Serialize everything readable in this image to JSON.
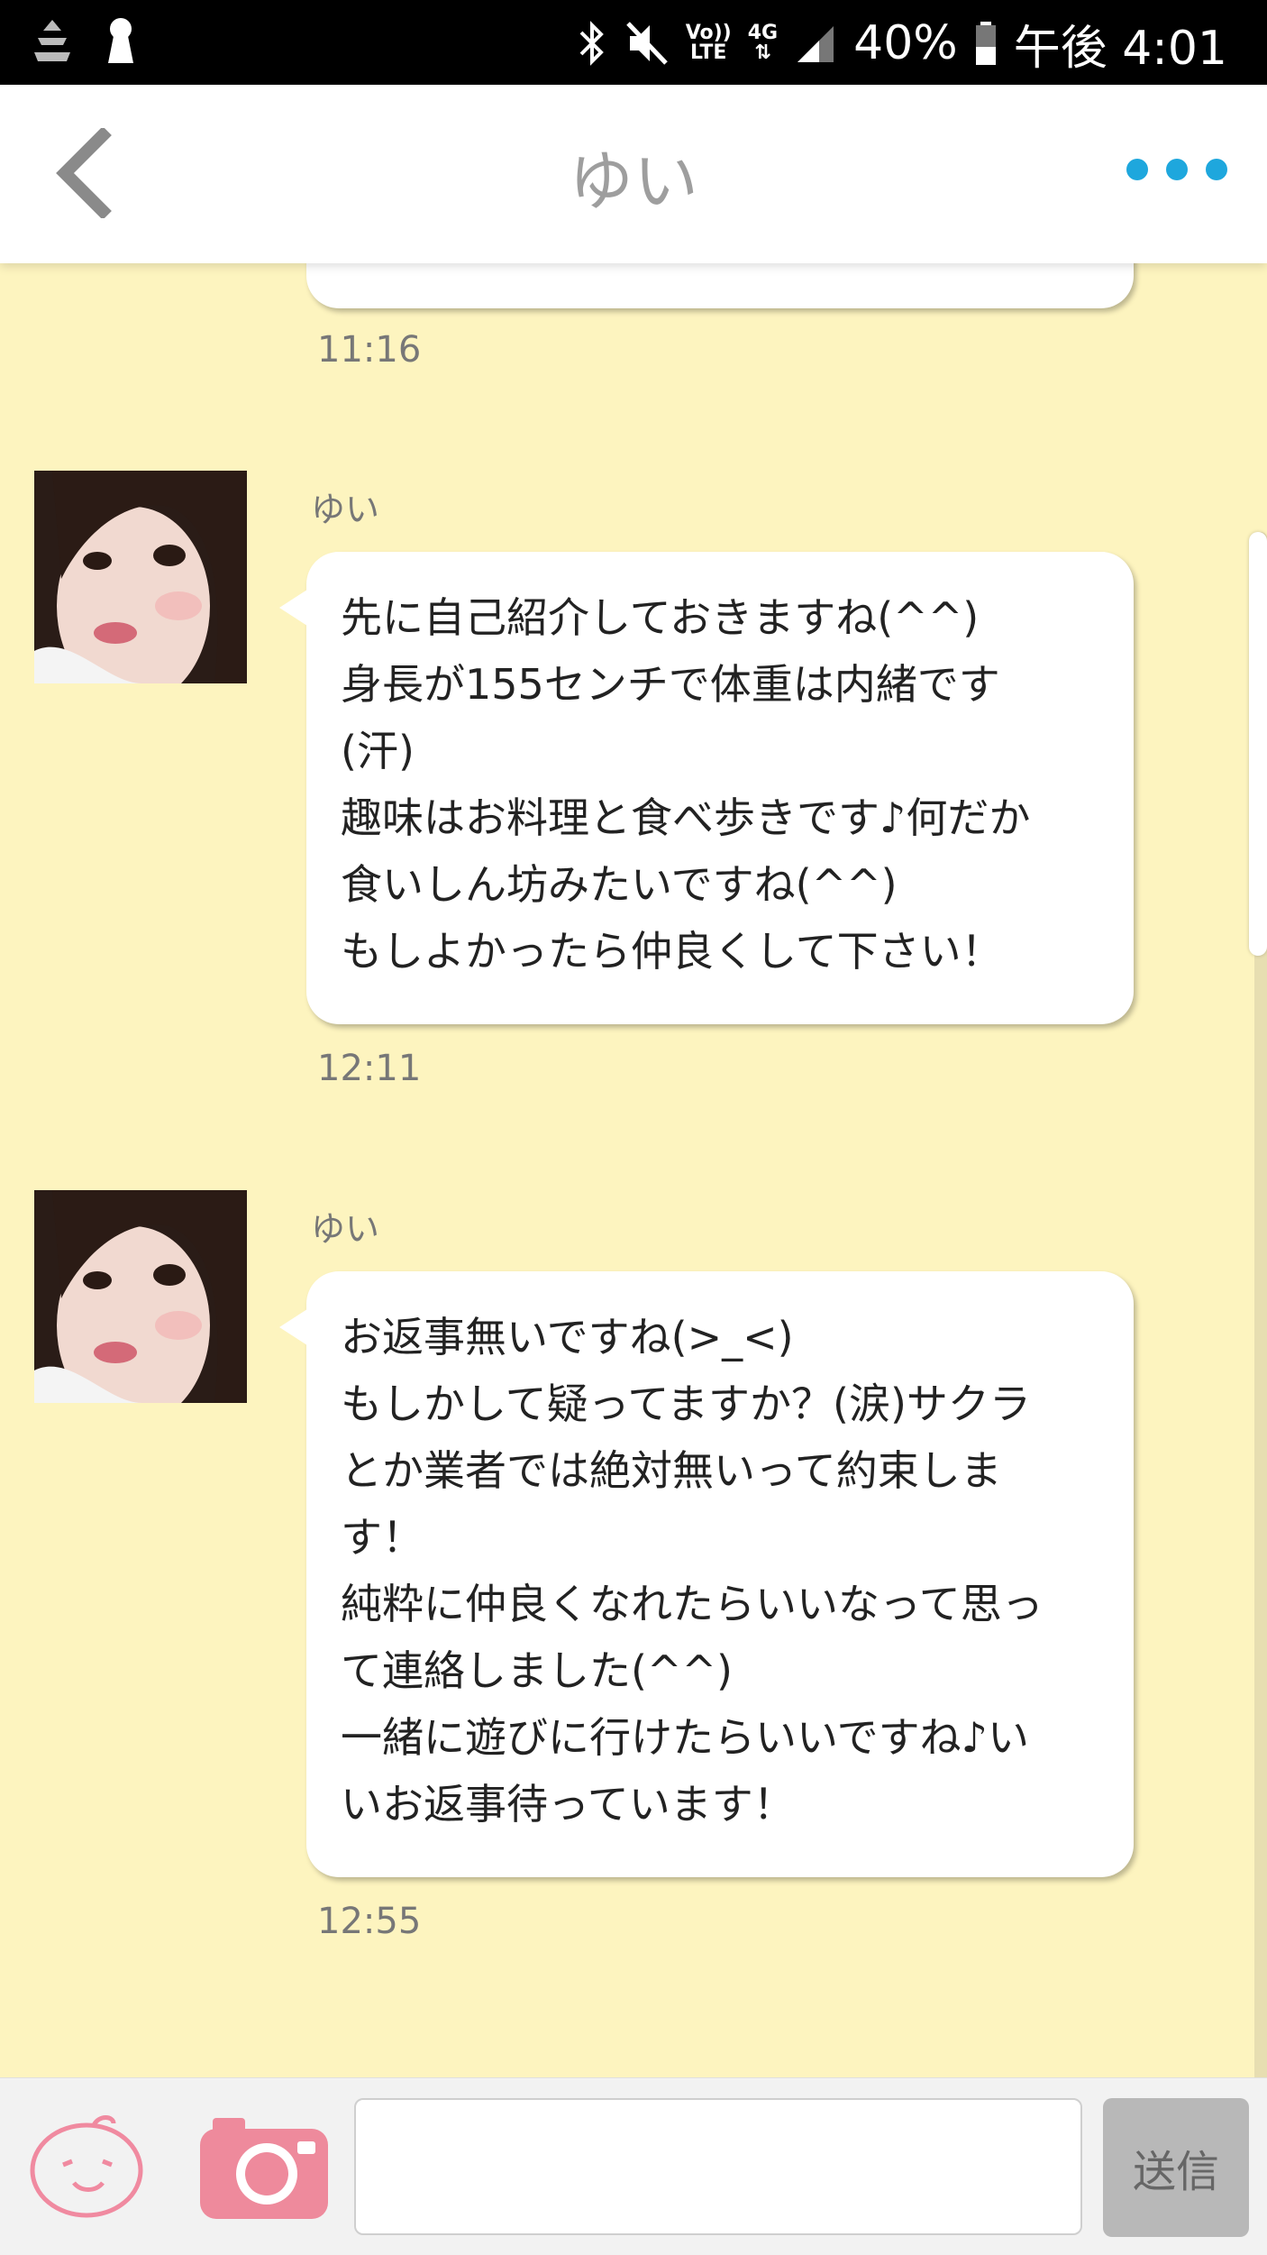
{
  "status_bar": {
    "battery": "40%",
    "time": "午後 4:01",
    "network_top": "Vo))",
    "network_bottom": "LTE",
    "signal_type": "4G",
    "icons": [
      "app-icon",
      "keyhole-icon",
      "bluetooth-icon",
      "mute-icon",
      "signal-icon",
      "battery-icon"
    ]
  },
  "header": {
    "title": "ゆい",
    "back_icon": "chevron-left-icon",
    "menu_icon": "more-dots-icon",
    "accent": "#1ea7dd"
  },
  "messages": [
    {
      "time": "11:16"
    },
    {
      "sender": "ゆい",
      "lines": [
        "先に自己紹介しておきますね(^^)",
        "身長が155センチで体重は内緒です",
        "(汗)",
        "趣味はお料理と食べ歩きです♪何だか",
        "食いしん坊みたいですね(^^)",
        "もしよかったら仲良くして下さい！"
      ],
      "time": "12:11"
    },
    {
      "sender": "ゆい",
      "lines": [
        "お返事無いですね(>_<)",
        "もしかして疑ってますか？(涙)サクラ",
        "とか業者では絶対無いって約束しま",
        "す！",
        "純粋に仲良くなれたらいいなって思っ",
        "て連絡しました(^^)",
        "一緒に遊びに行けたらいいですね♪い",
        "いお返事待っています！"
      ],
      "time": "12:55"
    }
  ],
  "input_bar": {
    "placeholder": "",
    "send_label": "送信",
    "stamp_icon": "smiley-face-icon",
    "camera_icon": "camera-icon"
  },
  "colors": {
    "chat_background": "#fdf4bf",
    "stamp_pink": "#f08aa0",
    "camera_pink": "#ee8a9c"
  }
}
